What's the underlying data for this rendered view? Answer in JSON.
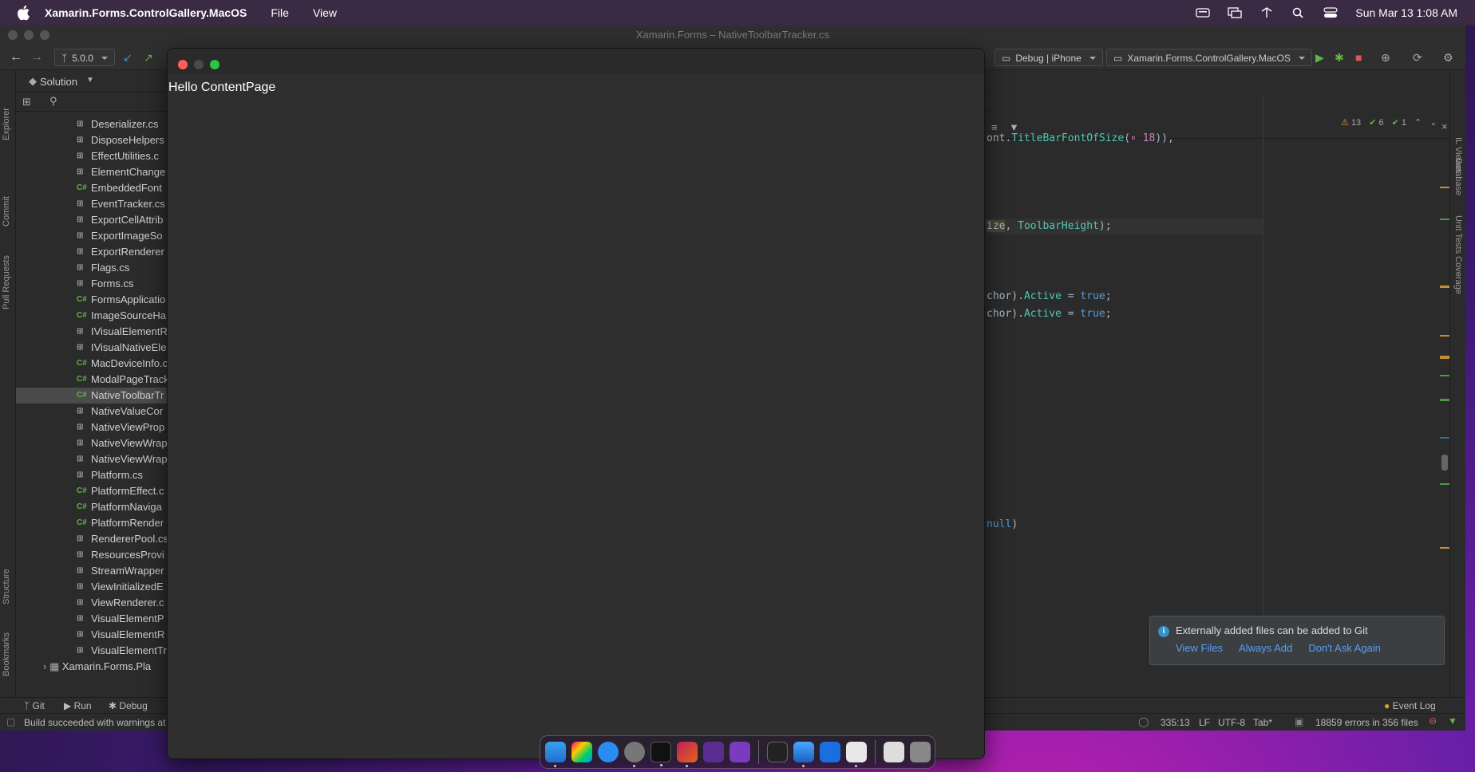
{
  "menubar": {
    "app_name": "Xamarin.Forms.ControlGallery.MacOS",
    "items": [
      "File",
      "View"
    ],
    "clock": "Sun Mar 13  1:08 AM"
  },
  "ide": {
    "title": "Xamarin.Forms – NativeToolbarTracker.cs",
    "branch": "5.0.0",
    "config": "Debug | iPhone",
    "run_target": "Xamarin.Forms.ControlGallery.MacOS",
    "solution_label": "Solution",
    "files": [
      {
        "icon": "grid",
        "name": "Deserializer.cs"
      },
      {
        "icon": "grid",
        "name": "DisposeHelpers"
      },
      {
        "icon": "grid",
        "name": "EffectUtilities.c"
      },
      {
        "icon": "grid",
        "name": "ElementChange"
      },
      {
        "icon": "cs",
        "name": "EmbeddedFont"
      },
      {
        "icon": "grid",
        "name": "EventTracker.cs"
      },
      {
        "icon": "grid",
        "name": "ExportCellAttrib"
      },
      {
        "icon": "grid",
        "name": "ExportImageSo"
      },
      {
        "icon": "grid",
        "name": "ExportRenderer"
      },
      {
        "icon": "grid",
        "name": "Flags.cs"
      },
      {
        "icon": "grid",
        "name": "Forms.cs"
      },
      {
        "icon": "cs",
        "name": "FormsApplicatio"
      },
      {
        "icon": "cs",
        "name": "ImageSourceHa"
      },
      {
        "icon": "grid",
        "name": "IVisualElementR"
      },
      {
        "icon": "grid",
        "name": "IVisualNativeEle"
      },
      {
        "icon": "cs",
        "name": "MacDeviceInfo.c"
      },
      {
        "icon": "cs",
        "name": "ModalPageTrack"
      },
      {
        "icon": "cs",
        "name": "NativeToolbarTr"
      },
      {
        "icon": "grid",
        "name": "NativeValueCor"
      },
      {
        "icon": "grid",
        "name": "NativeViewProp"
      },
      {
        "icon": "grid",
        "name": "NativeViewWrap"
      },
      {
        "icon": "grid",
        "name": "NativeViewWrap"
      },
      {
        "icon": "grid",
        "name": "Platform.cs"
      },
      {
        "icon": "cs",
        "name": "PlatformEffect.c"
      },
      {
        "icon": "cs",
        "name": "PlatformNaviga"
      },
      {
        "icon": "cs",
        "name": "PlatformRender"
      },
      {
        "icon": "grid",
        "name": "RendererPool.cs"
      },
      {
        "icon": "grid",
        "name": "ResourcesProvi"
      },
      {
        "icon": "grid",
        "name": "StreamWrapper"
      },
      {
        "icon": "grid",
        "name": "ViewInitializedE"
      },
      {
        "icon": "grid",
        "name": "ViewRenderer.c"
      },
      {
        "icon": "grid",
        "name": "VisualElementP"
      },
      {
        "icon": "grid",
        "name": "VisualElementR"
      },
      {
        "icon": "grid",
        "name": "VisualElementTr"
      }
    ],
    "project_node": "Xamarin.Forms.Pla",
    "code_lines": {
      "l1_a": "ont.",
      "l1_b": "TitleBarFontOfSize",
      "l1_c": "(",
      "l1_d": "∘ 18",
      "l1_e": ")),",
      "l2_a": "ize",
      "l2_b": ", ",
      "l2_c": "ToolbarHeight",
      "l2_d": ");",
      "l3_a": "chor).",
      "l3_b": "Active",
      "l3_c": " = ",
      "l3_d": "true",
      "l3_e": ";",
      "l4_a": "chor).",
      "l4_b": "Active",
      "l4_c": " = ",
      "l4_d": "true",
      "l4_e": ";",
      "l5_a": "null",
      "l5_b": ")"
    },
    "inspections": {
      "warnings": "13",
      "weak": "6",
      "ok": "1"
    },
    "left_tabs": [
      "Explorer",
      "Commit",
      "Pull Requests",
      "Structure",
      "Bookmarks"
    ],
    "right_tabs": [
      "IL Viewer",
      "Database",
      "Unit Tests Coverage"
    ],
    "bottom_tabs": [
      "Git",
      "Run",
      "Debug"
    ],
    "event_log": "Event Log",
    "status": {
      "message": "Build succeeded with warnings at",
      "position": "335:13",
      "line_ending": "LF",
      "encoding": "UTF-8",
      "indent": "Tab*",
      "errors": "18859 errors in 356 files"
    },
    "notification": {
      "message": "Externally added files can be added to Git",
      "links": [
        "View Files",
        "Always Add",
        "Don't Ask Again"
      ]
    }
  },
  "app_window": {
    "content_text": "Hello ContentPage"
  },
  "colors": {
    "accent_green": "#62b543",
    "link_blue": "#589df6",
    "stop_red": "#e05555"
  }
}
